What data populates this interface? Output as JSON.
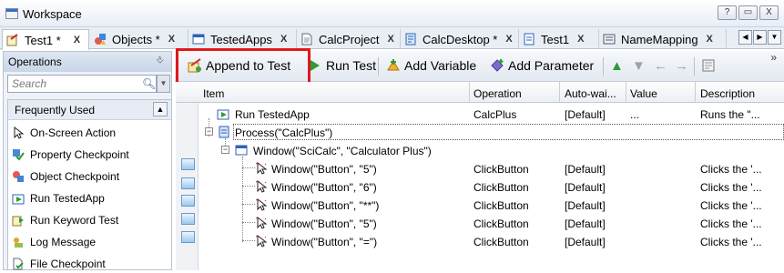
{
  "window": {
    "title": "Workspace",
    "controls": [
      "?",
      "▭",
      "X"
    ]
  },
  "tabs": [
    {
      "label": "Test1 *",
      "close": "X"
    },
    {
      "label": "Objects *",
      "close": "X"
    },
    {
      "label": "TestedApps",
      "close": "X"
    },
    {
      "label": "CalcProject",
      "close": "X"
    },
    {
      "label": "CalcDesktop *",
      "close": "X"
    },
    {
      "label": "Test1",
      "close": "X"
    },
    {
      "label": "NameMapping",
      "close": "X"
    }
  ],
  "tab_nav": [
    "◀",
    "▶",
    "▼"
  ],
  "operations": {
    "title": "Operations",
    "search_placeholder": "Search",
    "group_label": "Frequently Used",
    "items": [
      "On-Screen Action",
      "Property Checkpoint",
      "Object Checkpoint",
      "Run TestedApp",
      "Run Keyword Test",
      "Log Message",
      "File Checkpoint"
    ]
  },
  "toolbar": {
    "append": "Append to Test",
    "run": "Run Test",
    "add_variable": "Add Variable",
    "add_parameter": "Add Parameter",
    "more": "»"
  },
  "columns": {
    "item": "Item",
    "operation": "Operation",
    "autowait": "Auto-wai...",
    "value": "Value",
    "description": "Description"
  },
  "rows": [
    {
      "item": "Run TestedApp",
      "operation": "CalcPlus",
      "autowait": "[Default]",
      "value": "...",
      "description": "Runs the \"..."
    },
    {
      "item": "Process(\"CalcPlus\")",
      "operation": "",
      "autowait": "",
      "value": "",
      "description": ""
    },
    {
      "item": "Window(\"SciCalc\", \"Calculator Plus\")",
      "operation": "",
      "autowait": "",
      "value": "",
      "description": ""
    },
    {
      "item": "Window(\"Button\", \"5\")",
      "operation": "ClickButton",
      "autowait": "[Default]",
      "value": "",
      "description": "Clicks the '..."
    },
    {
      "item": "Window(\"Button\", \"6\")",
      "operation": "ClickButton",
      "autowait": "[Default]",
      "value": "",
      "description": "Clicks the '..."
    },
    {
      "item": "Window(\"Button\", \"**\")",
      "operation": "ClickButton",
      "autowait": "[Default]",
      "value": "",
      "description": "Clicks the '..."
    },
    {
      "item": "Window(\"Button\", \"5\")",
      "operation": "ClickButton",
      "autowait": "[Default]",
      "value": "",
      "description": "Clicks the '..."
    },
    {
      "item": "Window(\"Button\", \"=\")",
      "operation": "ClickButton",
      "autowait": "[Default]",
      "value": "",
      "description": "Clicks the '..."
    }
  ],
  "colors": {
    "highlight": "#e0181c",
    "header_bg": "#c9d6e8"
  }
}
